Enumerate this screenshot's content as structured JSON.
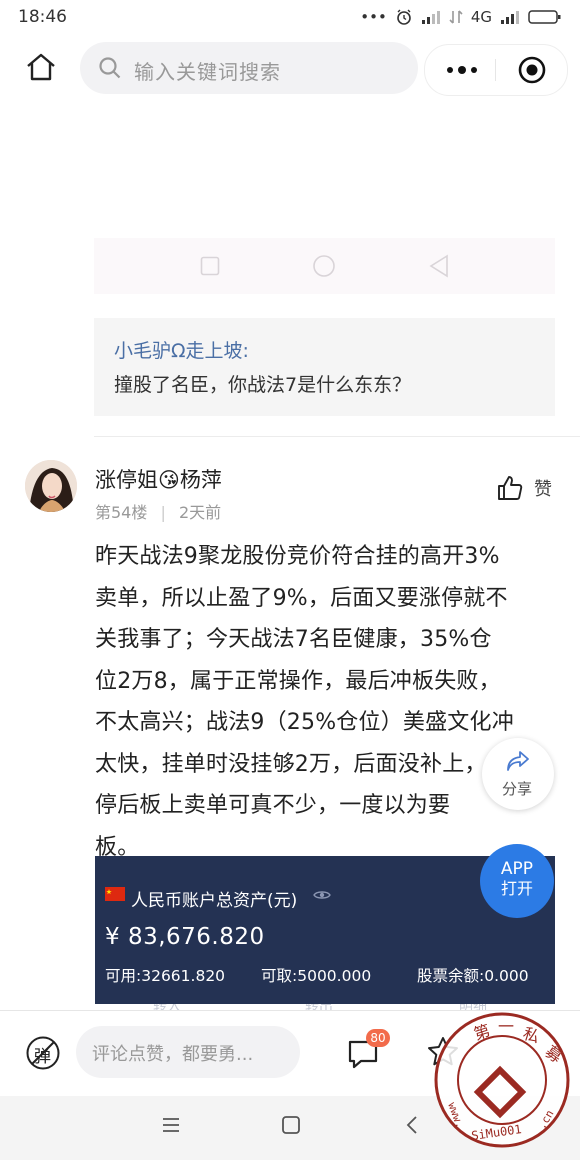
{
  "status_bar": {
    "time": "18:46",
    "dots": "•••",
    "network": "4G"
  },
  "header": {
    "search_placeholder": "输入关键词搜索"
  },
  "quote": {
    "author": "小毛驴Ω走上坡:",
    "text": "撞股了名臣，你战法7是什么东东？"
  },
  "post": {
    "username": "涨停姐😘杨萍",
    "floor": "第54楼",
    "sep": "|",
    "time": "2天前",
    "like_label": "赞",
    "lines": [
      "昨天战法9聚龙股份竞价符合挂的高开3%",
      "卖单，所以止盈了9%，后面又要涨停就不",
      "关我事了；今天战法7名臣健康，35%仓",
      "位2万8，属于正常操作，最后冲板失败，",
      "不太高兴；战法9（25%仓位）美盛文化冲",
      "太快，挂单时没挂够2万，后面没补上，",
      "停后板上卖单可真不少，一度以为要",
      "板。"
    ]
  },
  "account_card": {
    "label": "人民币账户总资产(元)",
    "amount": "¥ 83,676.820",
    "available": "可用:32661.820",
    "withdrawable": "可取:5000.000",
    "stock_balance": "股票余额:0.000",
    "tabs": [
      "转入",
      "转出",
      "明细"
    ]
  },
  "share": {
    "label": "分享"
  },
  "app_button": {
    "line1": "APP",
    "line2": "打开"
  },
  "bottom_bar": {
    "danmaku_label": "弹",
    "comment_placeholder": "评论点赞，都要勇...",
    "comment_count": "80"
  },
  "watermark": {
    "text": "第 一 私 募 · www.SiMu001.cn"
  },
  "colors": {
    "card_bg": "#243253",
    "link_blue": "#4a6fa5",
    "app_blue": "#2c7be5",
    "badge": "#f26b4b"
  }
}
